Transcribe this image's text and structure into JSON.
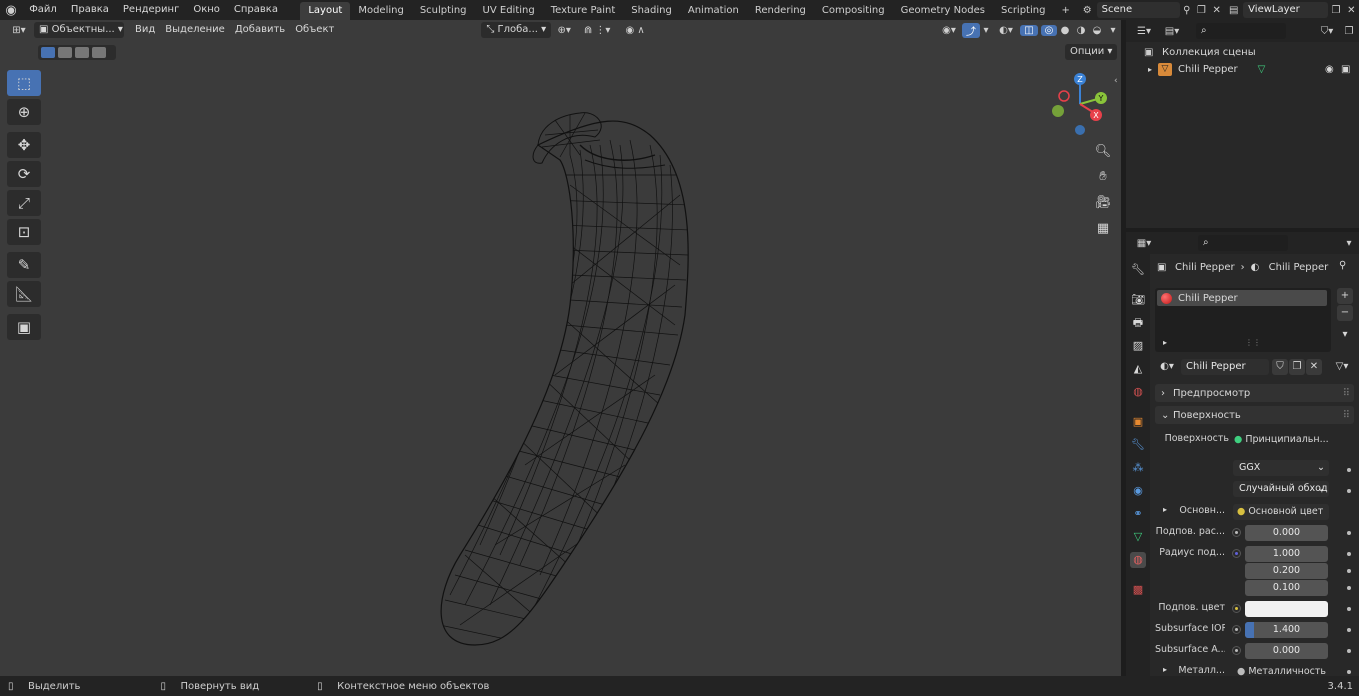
{
  "menu": {
    "items": [
      "Файл",
      "Правка",
      "Рендеринг",
      "Окно",
      "Справка"
    ]
  },
  "workspaces": {
    "tabs": [
      "Layout",
      "Modeling",
      "Sculpting",
      "UV Editing",
      "Texture Paint",
      "Shading",
      "Animation",
      "Rendering",
      "Compositing",
      "Geometry Nodes",
      "Scripting"
    ],
    "active": "Layout",
    "add": "+"
  },
  "scene": {
    "name": "Scene",
    "view_layer": "ViewLayer"
  },
  "viewport": {
    "mode": "Объектны...",
    "menus": [
      "Вид",
      "Выделение",
      "Добавить",
      "Объект"
    ],
    "transform_orientation": "Глоба...",
    "options": "Опции",
    "gizmo": {
      "x": "X",
      "y": "Y",
      "z": "Z"
    }
  },
  "outliner": {
    "collection": "Коллекция сцены",
    "object": "Chili Pepper"
  },
  "properties": {
    "breadcrumb_object": "Chili Pepper",
    "breadcrumb_material": "Chili Pepper",
    "slot": "Chili Pepper",
    "material_name": "Chili Pepper",
    "panels": {
      "preview": "Предпросмотр",
      "surface": "Поверхность"
    },
    "rows": {
      "surface_label": "Поверхность",
      "surface_value": "Принципиальн...",
      "distribution": "GGX",
      "subsurface_method": "Случайный обход",
      "base_label": "Основн...",
      "base_value": "Основной цвет",
      "subsurface_label": "Подпов. рас...",
      "subsurface_value": "0.000",
      "radius_label": "Радиус под...",
      "radius_1": "1.000",
      "radius_2": "0.200",
      "radius_3": "0.100",
      "subcolor_label": "Подпов. цвет",
      "ior_label": "Subsurface IOR",
      "ior_value": "1.400",
      "aniso_label": "Subsurface A...",
      "aniso_value": "0.000",
      "metal_label": "Металл...",
      "metal_value": "Металличность"
    }
  },
  "statusbar": {
    "select": "Выделить",
    "rotate": "Повернуть вид",
    "context": "Контекстное меню объектов",
    "version": "3.4.1"
  },
  "colors": {
    "accent": "#4772b3",
    "viewport_bg": "#3b3b3b",
    "panel_bg": "#282828",
    "x_axis": "#e8404a",
    "y_axis": "#8ac43a",
    "z_axis": "#3b82d6",
    "material_red": "#d02020"
  }
}
